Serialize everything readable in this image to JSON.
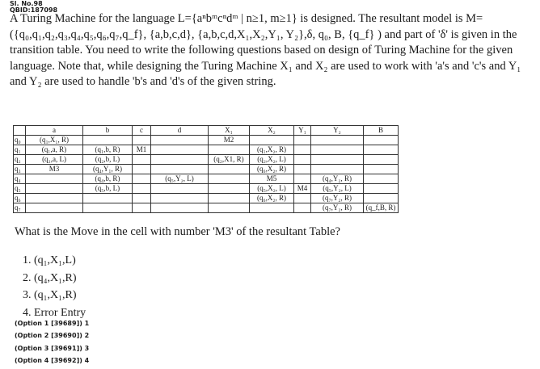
{
  "header": {
    "sl_no": "Sl. No.98",
    "qbid": "QBID:187098"
  },
  "paragraph": "A Turing Machine for the language L={aⁿbᵐcⁿdᵐ | n≥1, m≥1} is designed. The resultant model is M= ({q₀,q₁,q₂,q₃,q₄,q₅,q₆,q₇,q_f}, {a,b,c,d}, {a,b,c,d,X₁,X₂,Y₁, Y₂},δ, q₀, B, {q_f} ) and part of 'δ' is given in the\ntransition table. You need to write the following questions based on design of Turing Machine for the given\nlanguage. Note that, while designing the Turing Machine X₁ and X₂ are used to work with 'a's and 'c's and Y₁\nand Y₂ are used to handle 'b's and 'd's of the given string.",
  "table": {
    "headers": [
      "",
      "a",
      "b",
      "c",
      "d",
      "X₁",
      "X₂",
      "Y₁",
      "Y₂",
      "B"
    ],
    "rows": [
      [
        "q₀",
        "(q₁,X₁, R)",
        "",
        "",
        "",
        "M2",
        "",
        "",
        "",
        ""
      ],
      [
        "q₁",
        "(q₁,a, R)",
        "(q₁,b, R)",
        "M1",
        "",
        "",
        "(q₁,X₂, R)",
        "",
        "",
        ""
      ],
      [
        "q₂",
        "(q₂,a, L)",
        "(q₂,b, L)",
        "",
        "",
        "(q₂,X1, R)",
        "(q₂,X₂, L)",
        "",
        "",
        ""
      ],
      [
        "q₃",
        "M3",
        "(q₄,Y₁, R)",
        "",
        "",
        "",
        "(q₆,X₂, R)",
        "",
        "",
        ""
      ],
      [
        "q₄",
        "",
        "(q₄,b, R)",
        "",
        "(q₅,Y₂, L)",
        "",
        "M5",
        "",
        "(q₄,Y₂, R)",
        ""
      ],
      [
        "q₅",
        "",
        "(q₅,b, L)",
        "",
        "",
        "",
        "(q₅,X₂, L)",
        "M4",
        "(q₅,Y₂, L)",
        ""
      ],
      [
        "q₆",
        "",
        "",
        "",
        "",
        "",
        "(q₆,X₂, R)",
        "",
        "(q₇,Y₂, R)",
        ""
      ],
      [
        "q₇",
        "",
        "",
        "",
        "",
        "",
        "",
        "",
        "(q₇,Y₂, R)",
        "(q_f,B, R)"
      ]
    ]
  },
  "question": "What is the Move in the cell with number 'M3' of the resultant Table?",
  "options": [
    "1. (q₁,X₁,L)",
    "2. (q₄,X₁,R)",
    "3. (q₁,X₁,R)",
    "4. Error Entry"
  ],
  "option_ids": [
    "(Option 1 [39689]) 1",
    "(Option 2 [39690]) 2",
    "(Option 3 [39691]) 3",
    "(Option 4 [39692]) 4"
  ]
}
